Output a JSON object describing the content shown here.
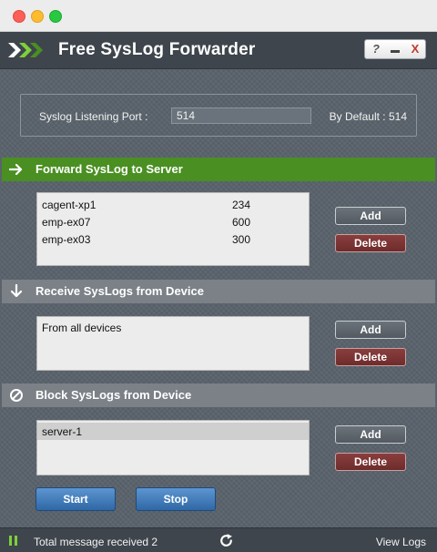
{
  "app": {
    "title": "Free SysLog Forwarder",
    "controls": {
      "help": "?",
      "close": "X"
    }
  },
  "port": {
    "label": "Syslog Listening Port :",
    "value": "514",
    "default_text": "By Default : 514"
  },
  "forward": {
    "title": "Forward SysLog to Server",
    "items": [
      {
        "name": "cagent-xp1",
        "port": "234"
      },
      {
        "name": "emp-ex07",
        "port": "600"
      },
      {
        "name": "emp-ex03",
        "port": "300"
      }
    ],
    "add_label": "Add",
    "delete_label": "Delete"
  },
  "receive": {
    "title": "Receive SysLogs from Device",
    "items": [
      {
        "name": "From all devices"
      }
    ],
    "add_label": "Add",
    "delete_label": "Delete"
  },
  "block": {
    "title": "Block SysLogs from Device",
    "items": [
      {
        "name": "server-1",
        "selected": true
      }
    ],
    "add_label": "Add",
    "delete_label": "Delete"
  },
  "actions": {
    "start_label": "Start",
    "stop_label": "Stop"
  },
  "status": {
    "message": "Total message received 2",
    "view_logs_label": "View Logs"
  },
  "icons": {
    "logo": "chevron-arrows-icon",
    "forward": "arrow-right-icon",
    "receive": "arrow-down-icon",
    "block": "block-icon",
    "refresh": "refresh-icon",
    "status": "status-indicator-icon"
  },
  "colors": {
    "accent_green": "#4a8f22",
    "section_gray": "#7b8187",
    "delete_red": "#6e2c2c",
    "start_blue": "#2f68a6"
  }
}
